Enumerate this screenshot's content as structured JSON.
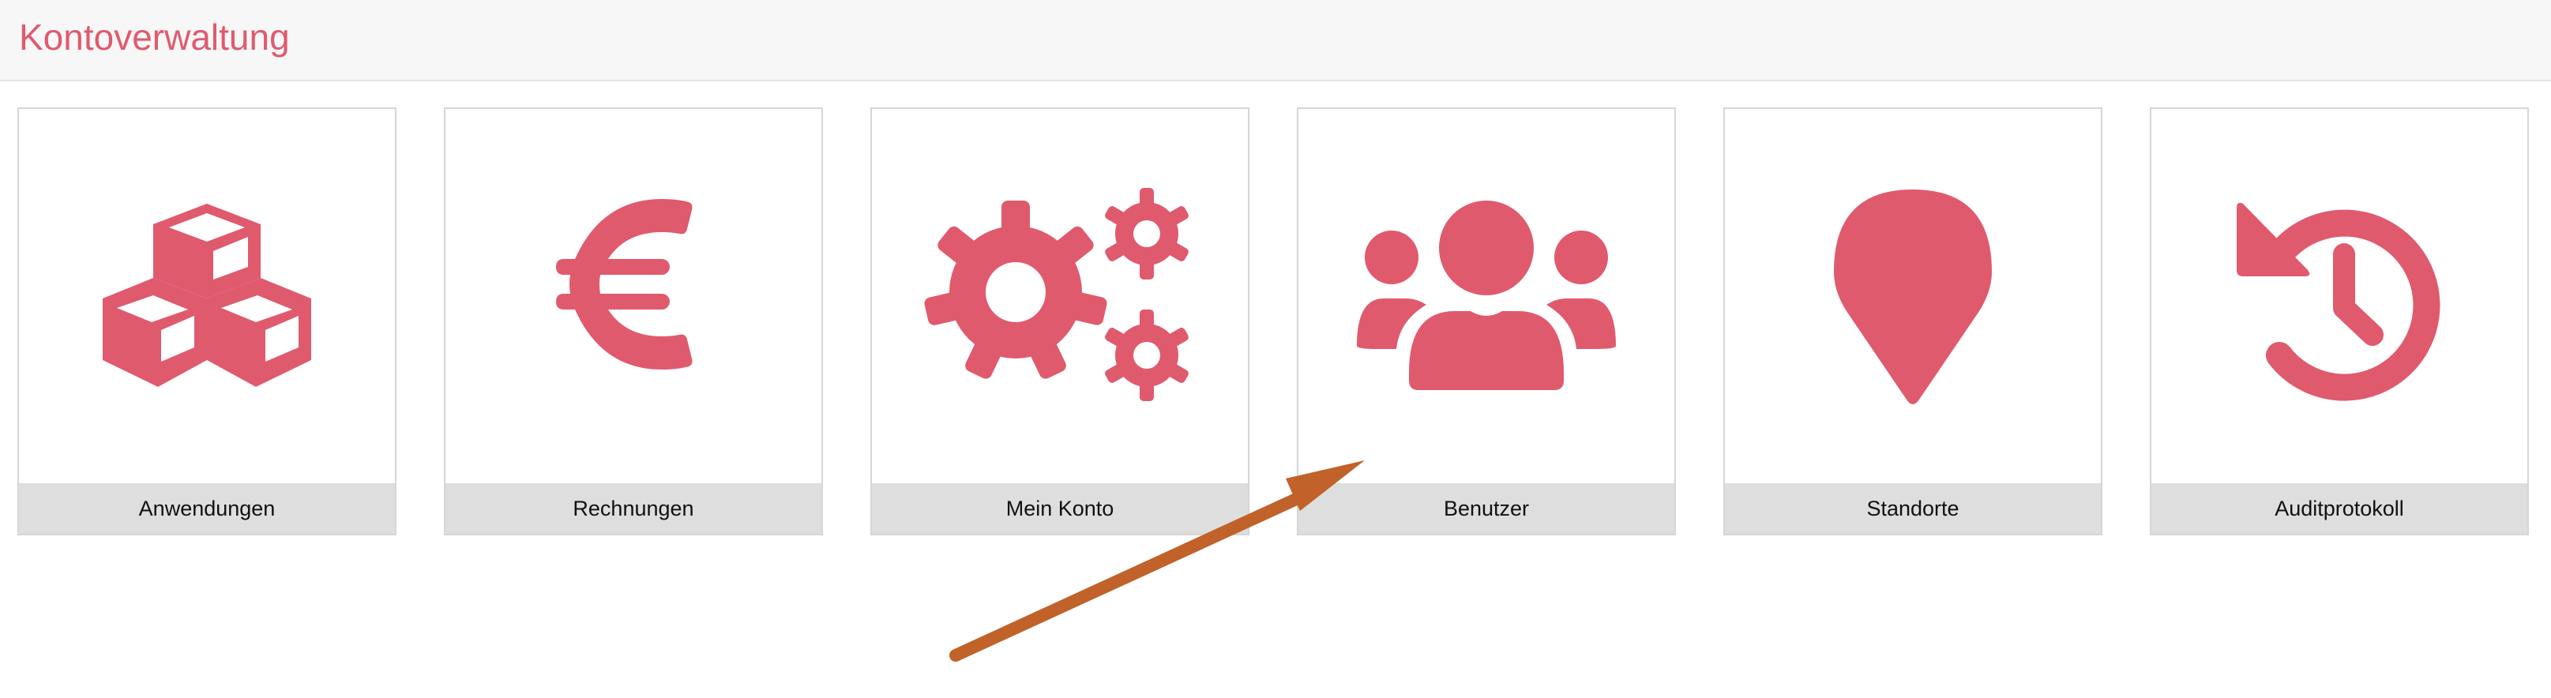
{
  "header": {
    "title": "Kontoverwaltung"
  },
  "colors": {
    "accent": "#e05a6e",
    "tile_label_bg": "#dedede",
    "annotation_arrow": "#c0622a"
  },
  "tiles": [
    {
      "label": "Anwendungen",
      "icon": "cubes-icon"
    },
    {
      "label": "Rechnungen",
      "icon": "euro-icon"
    },
    {
      "label": "Mein Konto",
      "icon": "gears-icon"
    },
    {
      "label": "Benutzer",
      "icon": "users-icon"
    },
    {
      "label": "Standorte",
      "icon": "map-pin-icon"
    },
    {
      "label": "Auditprotokoll",
      "icon": "history-icon"
    }
  ]
}
